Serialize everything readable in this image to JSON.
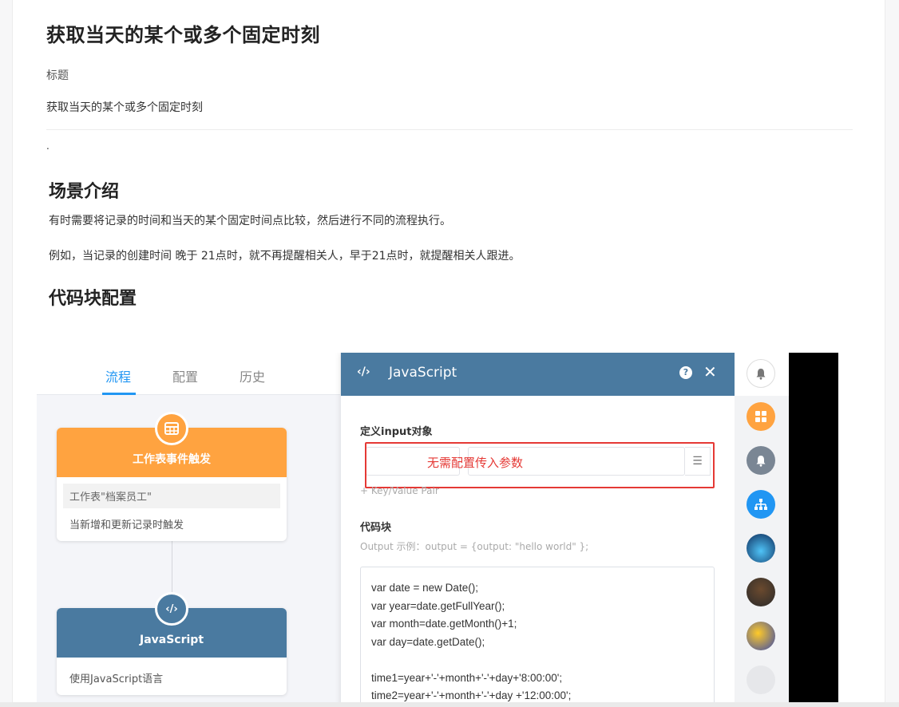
{
  "doc": {
    "title": "获取当天的某个或多个固定时刻",
    "field_label": "标题",
    "field_value": "获取当天的某个或多个固定时刻",
    "dot": ".",
    "section1_title": "场景介绍",
    "para1": "有时需要将记录的时间和当天的某个固定时间点比较，然后进行不同的流程执行。",
    "para2": "例如，当记录的创建时间 晚于 21点时，就不再提醒相关人，早于21点时，就提醒相关人跟进。",
    "section2_title": "代码块配置"
  },
  "screenshot": {
    "tabs": [
      {
        "label": "流程",
        "active": true
      },
      {
        "label": "配置",
        "active": false
      },
      {
        "label": "历史",
        "active": false
      }
    ],
    "node1": {
      "title": "工作表事件触发",
      "sub": "工作表\"档案员工\"",
      "desc": "当新增和更新记录时触发",
      "color": "#ffa340"
    },
    "node2": {
      "title": "JavaScript",
      "desc": "使用JavaScript语言",
      "color": "#4a7aa0"
    },
    "panel": {
      "title": "JavaScript",
      "code_icon": "‹/›",
      "help": "?",
      "close": "✕",
      "input_label": "定义input对象",
      "annotation": "无需配置传入参数",
      "kv_add": "+ Key/Value Pair",
      "code_label": "代码块",
      "output_hint": "Output 示例：output = {output: \"hello world\" };",
      "code": "var date = new Date();\nvar year=date.getFullYear();\nvar month=date.getMonth()+1;\nvar day=date.getDate();\n\ntime1=year+'-'+month+'-'+day+'8:00:00';\ntime2=year+'-'+month+'-'+day +'12:00:00';"
    },
    "rail_icons": [
      "bell-icon",
      "apps-icon",
      "notification-icon",
      "org-chart-icon",
      "avatar",
      "avatar",
      "avatar",
      "avatar"
    ]
  }
}
